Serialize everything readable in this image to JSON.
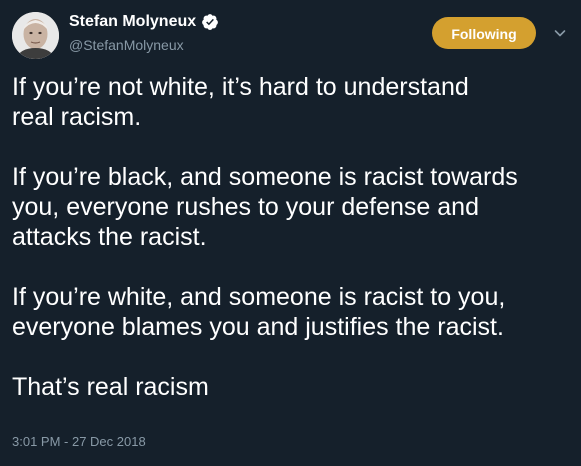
{
  "author": {
    "display_name": "Stefan Molyneux",
    "handle": "@StefanMolyneux",
    "verified": true,
    "avatar_icon": "avatar-photo"
  },
  "actions": {
    "follow_label": "Following",
    "follow_color": "#d4a02f",
    "more_icon": "chevron-down-icon"
  },
  "tweet": {
    "paragraphs": [
      "If you’re not white, it’s hard to understand\nreal racism.",
      "If you’re black, and someone is racist towards\nyou, everyone rushes to your defense and\nattacks the racist.",
      "If you’re white, and someone is racist to you,\neveryone blames you and justifies the racist.",
      "That’s real racism"
    ],
    "timestamp": "3:01 PM - 27 Dec 2018"
  },
  "theme": {
    "background": "#15202b",
    "text": "#ffffff",
    "secondary_text": "#8899a6",
    "verified_blue": "#ffffff"
  }
}
